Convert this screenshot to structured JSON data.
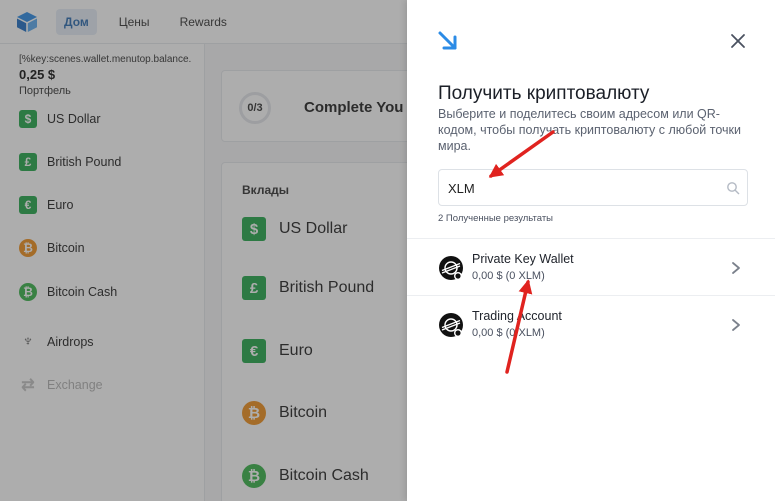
{
  "topbar": {
    "tabs": [
      {
        "label": "Дом",
        "active": true
      },
      {
        "label": "Цены",
        "active": false
      },
      {
        "label": "Rewards",
        "active": false
      }
    ]
  },
  "sidebar": {
    "balance_key": "[%key:scenes.wallet.menutop.balance.",
    "balance_value": "0,25 $",
    "balance_label": "Портфель",
    "items": [
      {
        "label": "US Dollar",
        "icon": "dollar-icon"
      },
      {
        "label": "British Pound",
        "icon": "pound-icon"
      },
      {
        "label": "Euro",
        "icon": "euro-icon"
      },
      {
        "label": "Bitcoin",
        "icon": "bitcoin-icon"
      },
      {
        "label": "Bitcoin Cash",
        "icon": "bitcoin-cash-icon"
      },
      {
        "label": "Airdrops",
        "icon": "airdrop-icon"
      },
      {
        "label": "Exchange",
        "icon": "exchange-icon"
      }
    ]
  },
  "main": {
    "progress": "0/3",
    "complete_title": "Complete You",
    "deposits_title": "Вклады",
    "deposits": [
      {
        "label": "US Dollar",
        "icon": "dollar-icon"
      },
      {
        "label": "British Pound",
        "icon": "pound-icon"
      },
      {
        "label": "Euro",
        "icon": "euro-icon"
      },
      {
        "label": "Bitcoin",
        "icon": "bitcoin-icon"
      },
      {
        "label": "Bitcoin Cash",
        "icon": "bitcoin-cash-icon"
      }
    ]
  },
  "drawer": {
    "title": "Получить криптовалюту",
    "description": "Выберите и поделитесь своим адресом или QR-кодом, чтобы получать криптовалюту с любой точки мира.",
    "search": {
      "value": "XLM",
      "placeholder": ""
    },
    "results_count": "2 Полученные результаты",
    "results": [
      {
        "name": "Private Key Wallet",
        "amount": "0,00 $ (0 XLM)",
        "icon": "stellar-icon"
      },
      {
        "name": "Trading Account",
        "amount": "0,00 $ (0 XLM)",
        "icon": "stellar-icon"
      }
    ]
  },
  "colors": {
    "accent": "#2b8be6",
    "annotation_arrow": "#e0231f",
    "green_asset": "#24a84a",
    "bitcoin_orange": "#f0901c",
    "overlay": "rgba(60,60,60,0.42)"
  }
}
